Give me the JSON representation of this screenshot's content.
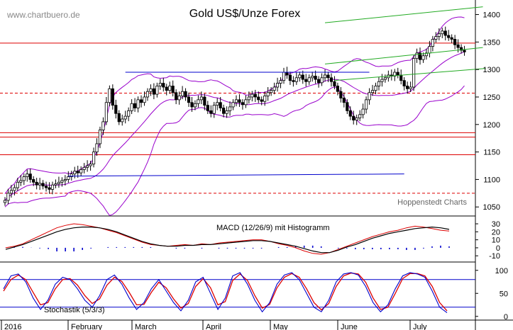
{
  "header": {
    "title": "Gold US$/Unze Forex",
    "watermark": "www.chartbuero.de",
    "source": "Hoppenstedt Charts"
  },
  "colors": {
    "up": "#ffffff",
    "down": "#000000",
    "bollinger": "#9900cc",
    "horizontal_lines": "#dd0000",
    "channel_blue": "#0000cc",
    "channel_green": "#22aa22",
    "macd_line": "#000000",
    "signal_line": "#dd0000",
    "histogram": "#0000cc",
    "stoch_k": "#0000cc",
    "stoch_d": "#dd0000"
  },
  "chart_data": [
    {
      "type": "candlestick",
      "title": "Gold US$/Unze Forex",
      "x_labels": [
        "2016",
        "February",
        "March",
        "April",
        "May",
        "June",
        "July"
      ],
      "y_ticks": [
        1050,
        1100,
        1150,
        1200,
        1250,
        1300,
        1350,
        1400
      ],
      "ylim": [
        1040,
        1420
      ],
      "closes": [
        1062,
        1075,
        1080,
        1085,
        1095,
        1098,
        1105,
        1110,
        1100,
        1095,
        1090,
        1093,
        1088,
        1085,
        1082,
        1090,
        1092,
        1095,
        1098,
        1100,
        1105,
        1110,
        1115,
        1112,
        1118,
        1122,
        1125,
        1128,
        1150,
        1165,
        1190,
        1205,
        1240,
        1265,
        1235,
        1220,
        1205,
        1210,
        1215,
        1225,
        1238,
        1230,
        1245,
        1240,
        1250,
        1260,
        1265,
        1255,
        1270,
        1275,
        1268,
        1262,
        1270,
        1258,
        1245,
        1252,
        1260,
        1250,
        1240,
        1232,
        1238,
        1245,
        1250,
        1235,
        1225,
        1220,
        1235,
        1240,
        1230,
        1220,
        1225,
        1232,
        1240,
        1245,
        1240,
        1236,
        1245,
        1250,
        1255,
        1250,
        1245,
        1242,
        1252,
        1258,
        1262,
        1268,
        1275,
        1280,
        1295,
        1290,
        1280,
        1278,
        1285,
        1290,
        1282,
        1278,
        1285,
        1288,
        1282,
        1276,
        1285,
        1290,
        1285,
        1278,
        1270,
        1260,
        1248,
        1240,
        1225,
        1215,
        1208,
        1212,
        1218,
        1228,
        1245,
        1258,
        1262,
        1270,
        1278,
        1282,
        1285,
        1290,
        1288,
        1295,
        1290,
        1280,
        1270,
        1265,
        1268,
        1320,
        1330,
        1318,
        1325,
        1330,
        1342,
        1355,
        1360,
        1365,
        1370,
        1362,
        1358,
        1355,
        1345,
        1340,
        1335,
        1332
      ],
      "horizontal_levels": [
        1348,
        1257,
        1185,
        1177,
        1145,
        1075
      ],
      "bollinger": "purple bands around price",
      "grid": false
    },
    {
      "type": "line",
      "title": "MACD (12/26/9) mit Histogramm",
      "y_ticks": [
        -10,
        0,
        10,
        20,
        30
      ],
      "ylim": [
        -16,
        38
      ],
      "series": [
        {
          "values": [
            -2,
            1,
            4,
            8,
            12,
            16,
            20,
            23,
            25,
            26,
            26,
            25,
            23,
            20,
            16,
            12,
            8,
            5,
            3,
            2,
            2,
            3,
            3,
            4,
            4,
            5,
            6,
            7,
            8,
            9,
            9,
            8,
            6,
            4,
            2,
            -1,
            -4,
            -6,
            -6,
            -3,
            1,
            4,
            8,
            12,
            15,
            18,
            20,
            22,
            24,
            25,
            26,
            25,
            23
          ]
        },
        {
          "values": [
            0,
            2,
            5,
            10,
            15,
            20,
            25,
            28,
            30,
            29,
            27,
            25,
            22,
            19,
            15,
            11,
            7,
            4,
            3,
            2,
            3,
            4,
            3,
            5,
            4,
            6,
            7,
            8,
            9,
            10,
            10,
            8,
            5,
            3,
            0,
            -4,
            -7,
            -8,
            -6,
            -2,
            2,
            6,
            10,
            14,
            17,
            20,
            22,
            25,
            27,
            26,
            24,
            22,
            21
          ]
        }
      ]
    },
    {
      "type": "line",
      "title": "Stochastik (5/3/3)",
      "y_ticks": [
        0,
        50,
        100
      ],
      "ylim": [
        -5,
        115
      ],
      "hlines": [
        80,
        20
      ],
      "series": [
        {
          "values": [
            60,
            88,
            92,
            75,
            40,
            15,
            35,
            70,
            85,
            80,
            60,
            35,
            20,
            45,
            80,
            90,
            70,
            40,
            15,
            30,
            60,
            80,
            55,
            30,
            12,
            35,
            75,
            85,
            50,
            15,
            40,
            88,
            95,
            70,
            35,
            10,
            30,
            70,
            90,
            95,
            80,
            50,
            20,
            10,
            35,
            75,
            92,
            95,
            90,
            65,
            30,
            10,
            25,
            60,
            88,
            95,
            92,
            85,
            55,
            20,
            8
          ]
        },
        {
          "values": [
            55,
            80,
            90,
            80,
            52,
            25,
            30,
            60,
            80,
            82,
            68,
            45,
            28,
            38,
            68,
            85,
            76,
            52,
            25,
            26,
            52,
            74,
            62,
            38,
            18,
            28,
            65,
            82,
            62,
            25,
            32,
            78,
            92,
            78,
            45,
            18,
            26,
            62,
            85,
            93,
            85,
            60,
            30,
            14,
            28,
            65,
            88,
            94,
            92,
            74,
            40,
            15,
            20,
            50,
            82,
            93,
            93,
            88,
            65,
            30,
            12
          ]
        }
      ]
    }
  ]
}
